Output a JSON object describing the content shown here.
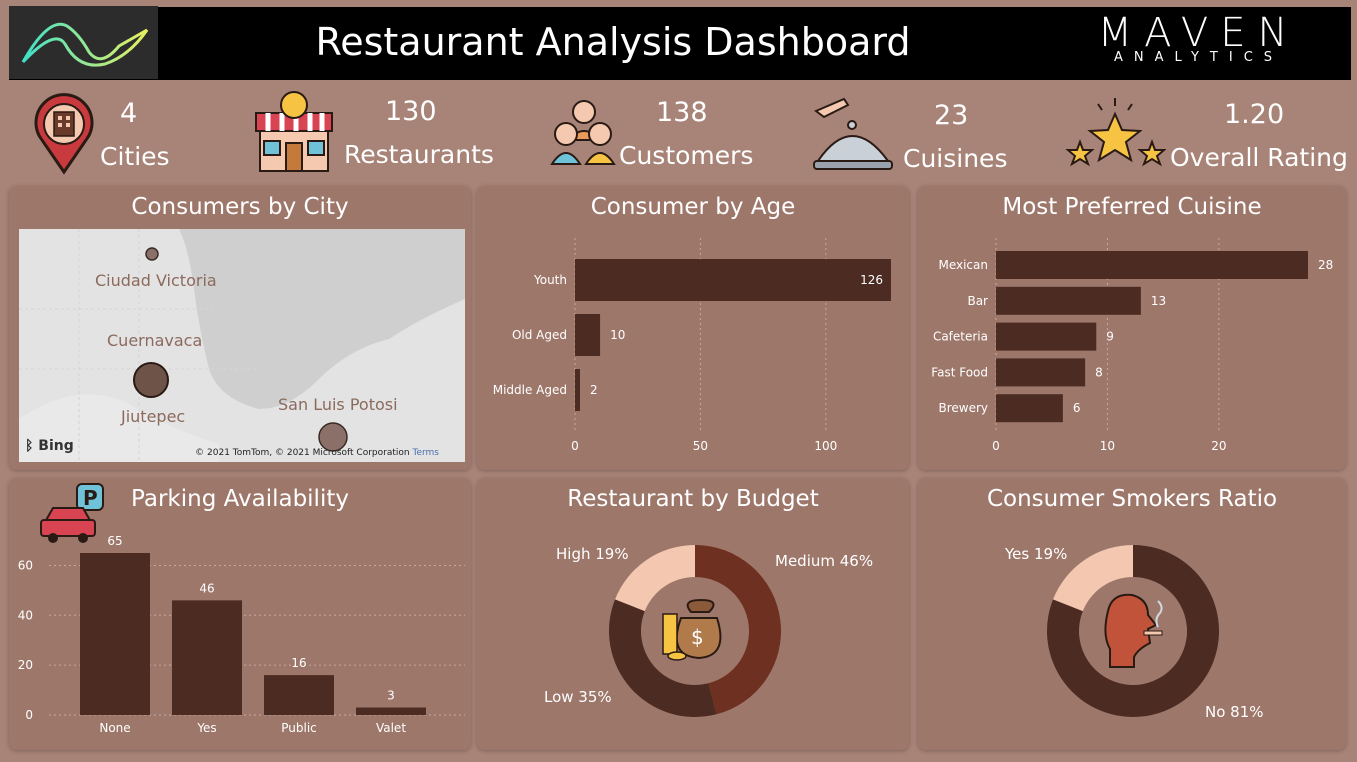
{
  "header": {
    "title": "Restaurant Analysis Dashboard",
    "brand_main": "MAVEN",
    "brand_sub": "ANALYTICS"
  },
  "kpis": {
    "cities": {
      "value": "4",
      "label": "Cities"
    },
    "restaurants": {
      "value": "130",
      "label": "Restaurants"
    },
    "customers": {
      "value": "138",
      "label": "Customers"
    },
    "cuisines": {
      "value": "23",
      "label": "Cuisines"
    },
    "rating": {
      "value": "1.20",
      "label": "Overall Rating"
    }
  },
  "map": {
    "title": "Consumers by City",
    "cities": [
      "Ciudad Victoria",
      "Cuernavaca",
      "Jiutepec",
      "San Luis Potosi"
    ],
    "provider": "Bing",
    "copyright": "© 2021 TomTom, © 2021 Microsoft Corporation",
    "terms": "Terms"
  },
  "colors": {
    "bar": "#4b2b22",
    "dark": "#4b2b22",
    "medium": "#6e3020",
    "light": "#f3c7b0",
    "card": "#9e776b"
  },
  "chart_data": [
    {
      "type": "bar",
      "orientation": "horizontal",
      "title": "Consumer by Age",
      "categories": [
        "Youth",
        "Old Aged",
        "Middle Aged"
      ],
      "values": [
        126,
        10,
        2
      ],
      "xlim": [
        0,
        126
      ],
      "ticks": [
        0,
        50,
        100
      ],
      "grid": true
    },
    {
      "type": "bar",
      "orientation": "horizontal",
      "title": "Most Preferred Cuisine",
      "categories": [
        "Mexican",
        "Bar",
        "Cafeteria",
        "Fast Food",
        "Brewery"
      ],
      "values": [
        28,
        13,
        9,
        8,
        6
      ],
      "xlim": [
        0,
        28
      ],
      "ticks": [
        0,
        10,
        20
      ],
      "grid": true
    },
    {
      "type": "bar",
      "title": "Parking Availability",
      "categories": [
        "None",
        "Yes",
        "Public",
        "Valet"
      ],
      "values": [
        65,
        46,
        16,
        3
      ],
      "ylim": [
        0,
        65
      ],
      "ticks": [
        0,
        20,
        40,
        60
      ],
      "grid": true
    },
    {
      "type": "pie",
      "donut": true,
      "title": "Restaurant by Budget",
      "slices": [
        {
          "label": "Medium 46%",
          "value": 46,
          "color": "#6e3020"
        },
        {
          "label": "Low 35%",
          "value": 35,
          "color": "#4b2b22"
        },
        {
          "label": "High 19%",
          "value": 19,
          "color": "#f3c7b0"
        }
      ]
    },
    {
      "type": "pie",
      "donut": true,
      "title": "Consumer Smokers Ratio",
      "slices": [
        {
          "label": "No 81%",
          "value": 81,
          "color": "#4b2b22"
        },
        {
          "label": "Yes 19%",
          "value": 19,
          "color": "#f3c7b0"
        }
      ]
    }
  ]
}
